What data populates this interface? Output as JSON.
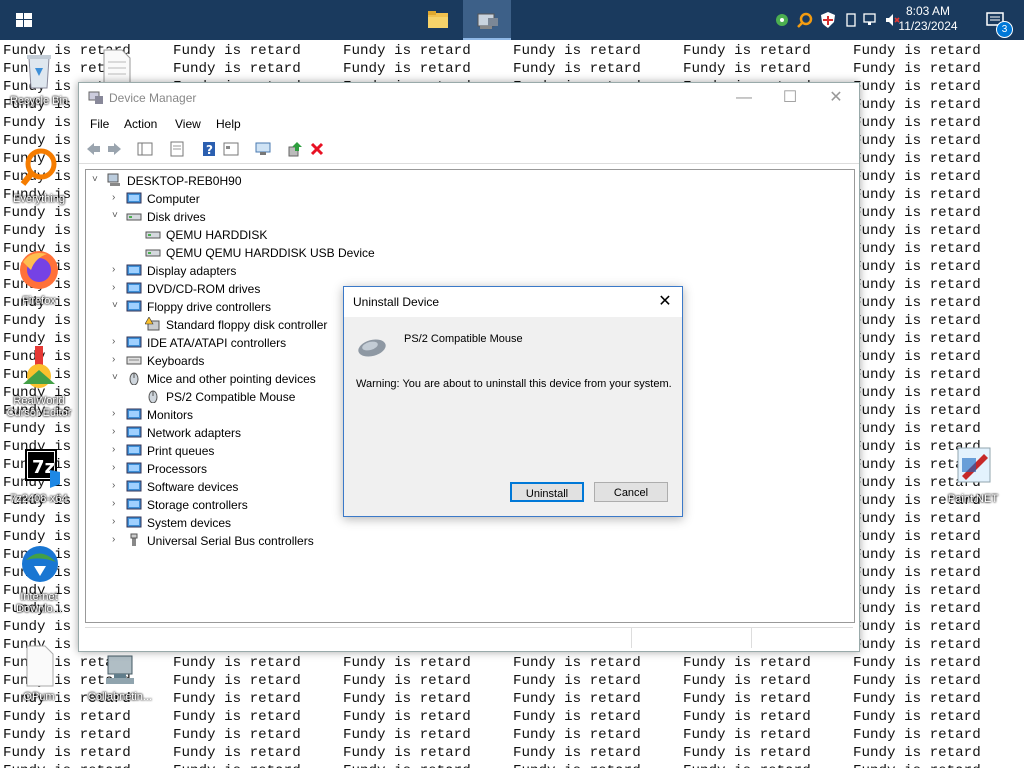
{
  "wallpaper": {
    "phrase": "Fundy is retard",
    "columns": 6,
    "rows": 41
  },
  "taskbar": {
    "items": [
      "windows-start",
      "file-explorer",
      "device-manager"
    ],
    "clock": {
      "time": "8:03 AM",
      "date": "11/23/2024"
    },
    "notifications_count": "3"
  },
  "desktop": {
    "left_icons": [
      {
        "name": "recycle-bin",
        "label": "Recycle Bin"
      },
      {
        "name": "everything",
        "label": "Everything"
      },
      {
        "name": "firefox",
        "label": "Firefox"
      },
      {
        "name": "realworld-cursor-editor",
        "label": "RealWorld Cursor Editor"
      },
      {
        "name": "7z2408-x64",
        "label": "7z2408-x64"
      },
      {
        "name": "internet-download-manager",
        "label": "Internet Downlo..."
      },
      {
        "name": "o-pum",
        "label": "OPum"
      },
      {
        "name": "collabnet",
        "label": "Collabnetin..."
      }
    ],
    "right_icons": [
      {
        "name": "paint-net",
        "label": "Paint.NET"
      }
    ]
  },
  "device_manager": {
    "title": "Device Manager",
    "menu": [
      "File",
      "Action",
      "View",
      "Help"
    ],
    "root": "DESKTOP-REB0H90",
    "tree": [
      {
        "label": "Computer",
        "expanded": false,
        "icon": "computer-icon",
        "children": []
      },
      {
        "label": "Disk drives",
        "expanded": true,
        "icon": "disk-drive-icon",
        "children": [
          "QEMU HARDDISK",
          "QEMU QEMU HARDDISK USB Device"
        ]
      },
      {
        "label": "Display adapters",
        "expanded": false,
        "icon": "display-adapter-icon",
        "children": []
      },
      {
        "label": "DVD/CD-ROM drives",
        "expanded": false,
        "icon": "dvd-drive-icon",
        "children": []
      },
      {
        "label": "Floppy drive controllers",
        "expanded": true,
        "icon": "floppy-controller-icon",
        "children": [
          "Standard floppy disk controller"
        ]
      },
      {
        "label": "IDE ATA/ATAPI controllers",
        "expanded": false,
        "icon": "ide-controller-icon",
        "children": []
      },
      {
        "label": "Keyboards",
        "expanded": false,
        "icon": "keyboard-icon",
        "children": []
      },
      {
        "label": "Mice and other pointing devices",
        "expanded": true,
        "icon": "mouse-icon",
        "children": [
          "PS/2 Compatible Mouse"
        ]
      },
      {
        "label": "Monitors",
        "expanded": false,
        "icon": "monitor-icon",
        "children": []
      },
      {
        "label": "Network adapters",
        "expanded": false,
        "icon": "network-adapter-icon",
        "children": []
      },
      {
        "label": "Print queues",
        "expanded": false,
        "icon": "printer-icon",
        "children": []
      },
      {
        "label": "Processors",
        "expanded": false,
        "icon": "processor-icon",
        "children": []
      },
      {
        "label": "Software devices",
        "expanded": false,
        "icon": "software-device-icon",
        "children": []
      },
      {
        "label": "Storage controllers",
        "expanded": false,
        "icon": "storage-controller-icon",
        "children": []
      },
      {
        "label": "System devices",
        "expanded": false,
        "icon": "system-device-icon",
        "children": []
      },
      {
        "label": "Universal Serial Bus controllers",
        "expanded": false,
        "icon": "usb-controller-icon",
        "children": []
      }
    ]
  },
  "dialog": {
    "title": "Uninstall Device",
    "device_name": "PS/2 Compatible Mouse",
    "warning": "Warning: You are about to uninstall this device from your system.",
    "uninstall_label": "Uninstall",
    "cancel_label": "Cancel"
  },
  "colors": {
    "taskbar": "#1a3a5e",
    "accent": "#0078d7",
    "delete_red": "#e81123"
  }
}
